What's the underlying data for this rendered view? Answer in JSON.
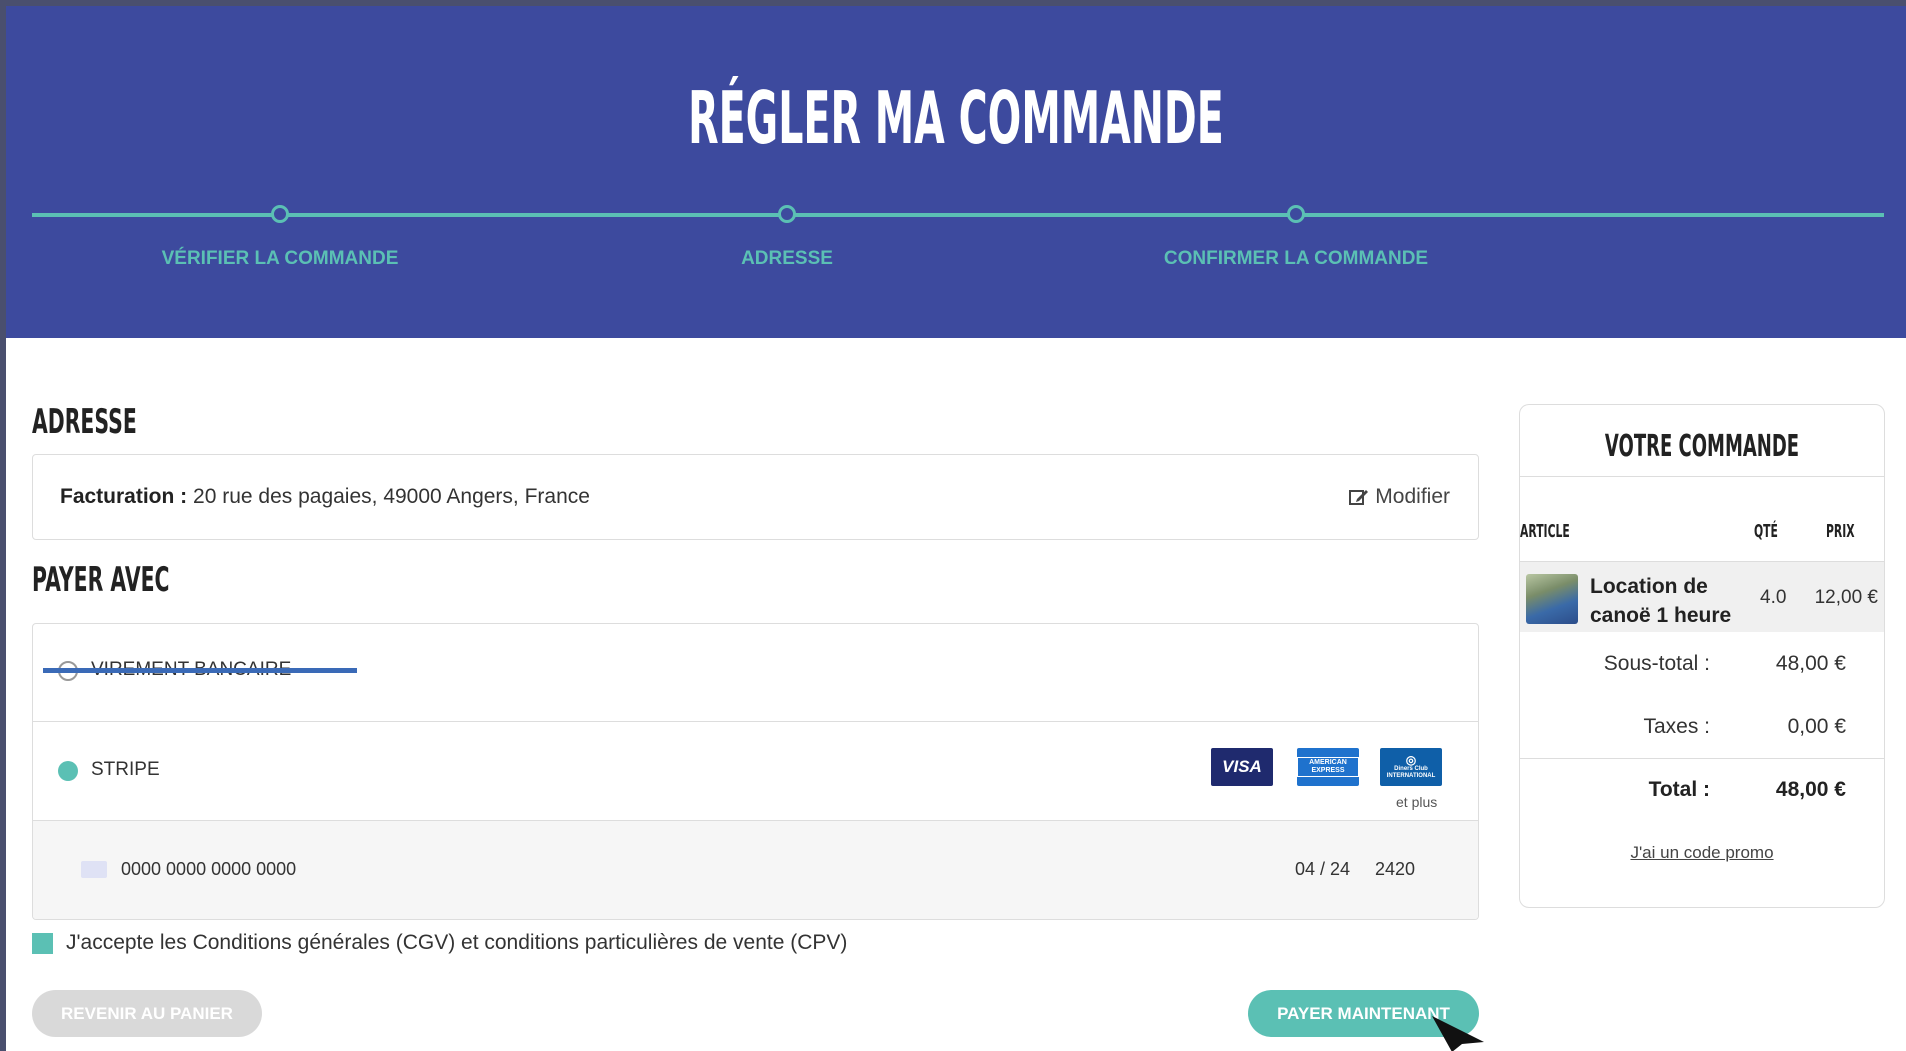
{
  "header": {
    "title": "RÉGLER MA COMMANDE",
    "steps": [
      "VÉRIFIER LA COMMANDE",
      "ADRESSE",
      "CONFIRMER LA COMMANDE"
    ]
  },
  "address": {
    "section_title": "ADRESSE",
    "label": "Facturation :",
    "value": "20 rue des pagaies, 49000 Angers, France",
    "modify_label": "Modifier"
  },
  "payment": {
    "section_title": "PAYER AVEC",
    "methods": [
      {
        "label": "VIREMENT BANCAIRE",
        "selected": false
      },
      {
        "label": "STRIPE",
        "selected": true
      }
    ],
    "card_logos": [
      "VISA",
      "AMERICAN EXPRESS",
      "Diners Club INTERNATIONAL"
    ],
    "more_label": "et plus",
    "card": {
      "number": "0000 0000 0000 0000",
      "expiry": "04 / 24",
      "cvc": "2420"
    }
  },
  "terms": {
    "label": "J'accepte les Conditions générales (CGV) et conditions particulières de vente (CPV)",
    "checked": true
  },
  "buttons": {
    "back": "REVENIR AU PANIER",
    "pay": "PAYER MAINTENANT"
  },
  "order": {
    "title": "VOTRE COMMANDE",
    "columns": {
      "article": "ARTICLE",
      "qty": "QTÉ",
      "price": "PRIX"
    },
    "items": [
      {
        "name": "Location de canoë 1 heure",
        "qty": "4.0",
        "price": "12,00 €"
      }
    ],
    "subtotal_label": "Sous-total :",
    "subtotal": "48,00 €",
    "taxes_label": "Taxes :",
    "taxes": "0,00 €",
    "total_label": "Total :",
    "total": "48,00 €",
    "promo_link": "J'ai un code promo"
  },
  "colors": {
    "header_bg": "#3d4a9e",
    "accent": "#5bc0b4",
    "visa": "#1f2a6e",
    "amex": "#1f72cd",
    "diners": "#0f5fa8"
  }
}
